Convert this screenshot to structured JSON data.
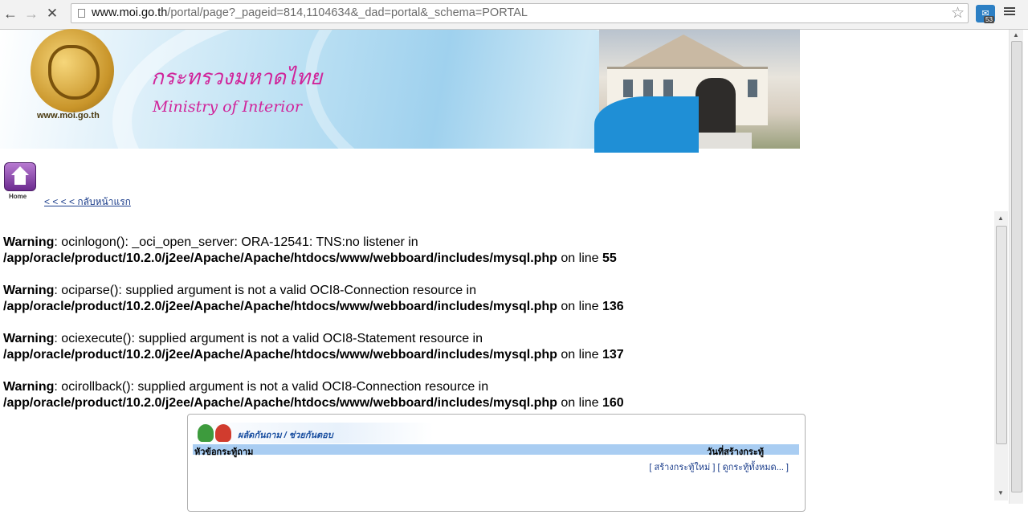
{
  "browser": {
    "url_host": "www.moi.go.th",
    "url_path": "/portal/page?_pageid=814,1104634&_dad=portal&_schema=PORTAL",
    "ext_badge": "53"
  },
  "banner": {
    "thai_name": "กระทรวงมหาดไทย",
    "eng_name": "Ministry of Interior",
    "site_url": "www.moi.go.th"
  },
  "home": {
    "label": "Home",
    "back_link": "< < < < กลับหน้าแรก"
  },
  "warnings": [
    {
      "label": "Warning",
      "message": ": ocinlogon(): _oci_open_server: ORA-12541: TNS:no listener in",
      "path": "/app/oracle/product/10.2.0/j2ee/Apache/Apache/htdocs/www/webboard/includes/mysql.php",
      "on_line": " on line ",
      "line": "55"
    },
    {
      "label": "Warning",
      "message": ": ociparse(): supplied argument is not a valid OCI8-Connection resource in",
      "path": "/app/oracle/product/10.2.0/j2ee/Apache/Apache/htdocs/www/webboard/includes/mysql.php",
      "on_line": " on line ",
      "line": "136"
    },
    {
      "label": "Warning",
      "message": ": ociexecute(): supplied argument is not a valid OCI8-Statement resource in",
      "path": "/app/oracle/product/10.2.0/j2ee/Apache/Apache/htdocs/www/webboard/includes/mysql.php",
      "on_line": " on line ",
      "line": "137"
    },
    {
      "label": "Warning",
      "message": ": ocirollback(): supplied argument is not a valid OCI8-Connection resource in",
      "path": "/app/oracle/product/10.2.0/j2ee/Apache/Apache/htdocs/www/webboard/includes/mysql.php",
      "on_line": " on line ",
      "line": "160"
    }
  ],
  "board": {
    "title": "ผลัดกันถาม / ช่วยกันตอบ",
    "col_topic": "หัวข้อกระทู้ถาม",
    "col_date": "วันที่สร้างกระทู้",
    "new_topic": "[ สร้างกระทู้ใหม่ ]",
    "all_topics": "[ ดูกระทู้ทั้งหมด... ]"
  }
}
